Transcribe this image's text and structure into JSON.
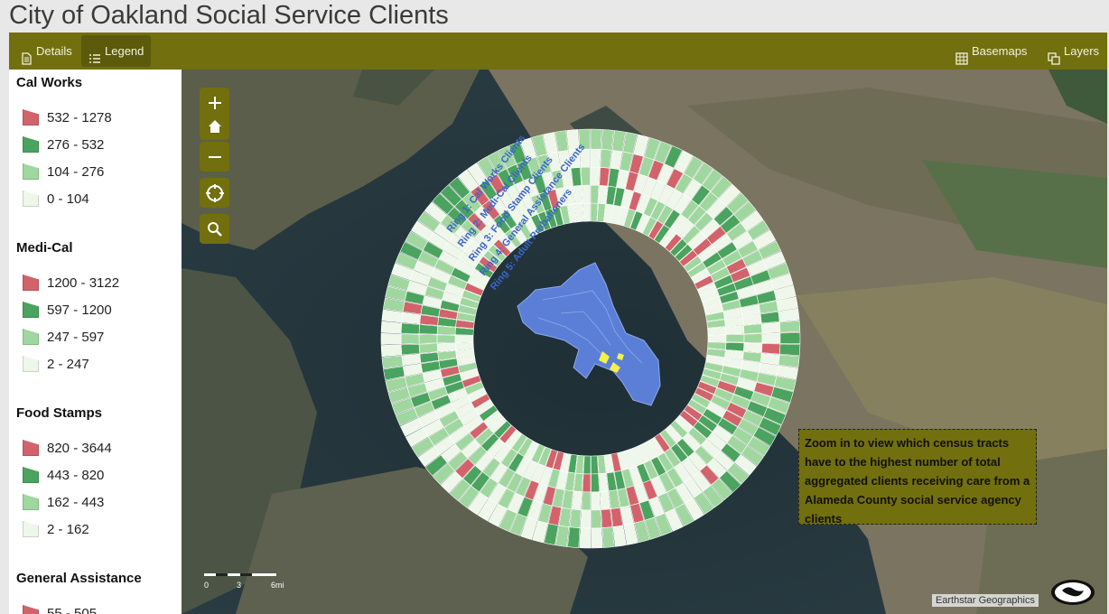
{
  "app": {
    "title": "City of Oakland Social Service Clients"
  },
  "toolbar": {
    "details_label": "Details",
    "legend_label": "Legend",
    "basemaps_label": "Basemaps",
    "layers_label": "Layers"
  },
  "legend": [
    {
      "title": "Cal Works",
      "items": [
        {
          "label": "532 - 1278",
          "color": "#d2636a"
        },
        {
          "label": "276 - 532",
          "color": "#4aa35e"
        },
        {
          "label": "104 - 276",
          "color": "#9fd79f"
        },
        {
          "label": "0 - 104",
          "color": "#eef7ea"
        }
      ]
    },
    {
      "title": "Medi-Cal",
      "items": [
        {
          "label": "1200 - 3122",
          "color": "#d2636a"
        },
        {
          "label": "597 - 1200",
          "color": "#4aa35e"
        },
        {
          "label": "247 - 597",
          "color": "#9fd79f"
        },
        {
          "label": "2 - 247",
          "color": "#eef7ea"
        }
      ]
    },
    {
      "title": "Food Stamps",
      "items": [
        {
          "label": "820 - 3644",
          "color": "#d2636a"
        },
        {
          "label": "443 - 820",
          "color": "#4aa35e"
        },
        {
          "label": "162 - 443",
          "color": "#9fd79f"
        },
        {
          "label": "2 - 162",
          "color": "#eef7ea"
        }
      ]
    },
    {
      "title": "General Assistance",
      "items": [
        {
          "label": "55 - 505",
          "color": "#d2636a"
        }
      ]
    }
  ],
  "map": {
    "ring_labels": [
      "Ring 1: Cal Works Clients",
      "Ring 2: Medi-Cal Clients",
      "Ring 3: Food Stamp Clients",
      "Ring 4: General Assistance Clients",
      "Ring 5: Adult Probationers"
    ],
    "info_text": "Zoom in to view which census tracts have to the highest number of total aggregated clients receiving care from a Alameda County social service agency clients",
    "attribution": "Earthstar Geographics",
    "scale_labels": [
      "0",
      "3",
      "6mi"
    ],
    "controls": {
      "zoom_in": "+",
      "zoom_out": "−"
    },
    "colors": {
      "high": "#d2636a",
      "mid_high": "#4aa35e",
      "mid_low": "#9fd79f",
      "low": "#eef7ea",
      "city": "#5b7fd6",
      "highlight": "#f5f04a"
    }
  }
}
